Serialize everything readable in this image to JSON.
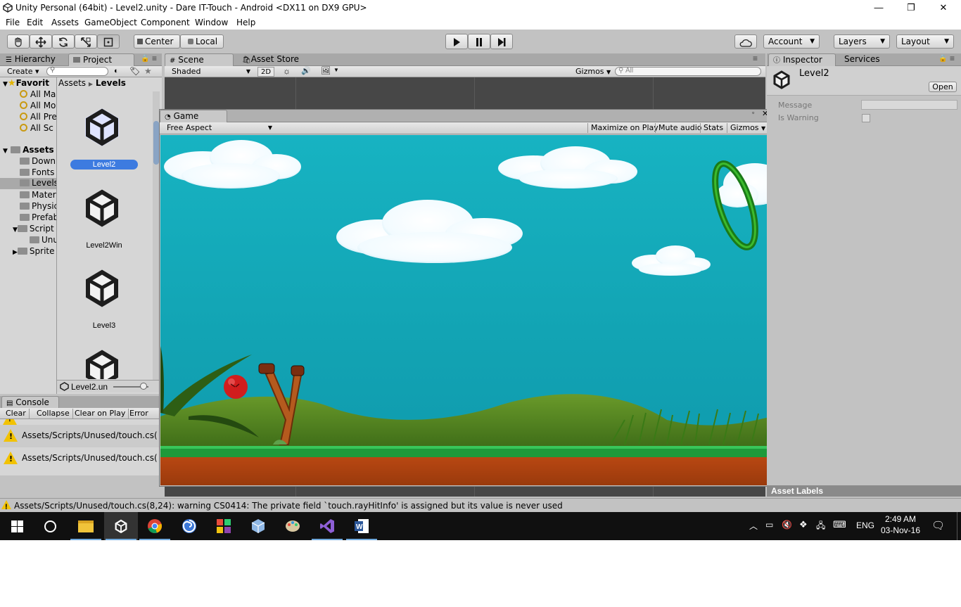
{
  "window": {
    "title": "Unity Personal (64bit) - Level2.unity - Dare IT-Touch - Android <DX11 on DX9 GPU>",
    "minimize": "—",
    "maximize": "❐",
    "close": "✕"
  },
  "menu": [
    "File",
    "Edit",
    "Assets",
    "GameObject",
    "Component",
    "Window",
    "Help"
  ],
  "toolbar": {
    "pivot_center": "Center",
    "pivot_local": "Local",
    "account": "Account",
    "layers": "Layers",
    "layout": "Layout"
  },
  "hierarchy": {
    "tab": "Hierarchy",
    "create": "Create"
  },
  "project": {
    "tab": "Project",
    "breadcrumb_root": "Assets",
    "breadcrumb_current": "Levels",
    "favorites_label": "Favorit",
    "favorites": [
      "All Ma",
      "All Mo",
      "All Pre",
      "All Sc"
    ],
    "assets_label": "Assets",
    "folders": [
      "Down",
      "Fonts",
      "Levels",
      "Mater",
      "Physic",
      "Prefab",
      "Script",
      "Unu",
      "Sprite"
    ],
    "items": [
      "Level2",
      "Level2Win",
      "Level3"
    ],
    "selected_file": "Level2.un"
  },
  "scene": {
    "tab": "Scene",
    "asset_store_tab": "Asset Store",
    "shading": "Shaded",
    "mode_2d": "2D",
    "gizmos": "Gizmos",
    "search_placeholder": "All"
  },
  "game": {
    "tab": "Game",
    "aspect": "Free Aspect",
    "maximize_on_play": "Maximize on Play",
    "mute_audio": "Mute audio",
    "stats": "Stats",
    "gizmos": "Gizmos"
  },
  "inspector": {
    "tab": "Inspector",
    "services_tab": "Services",
    "object_name": "Level2",
    "open_button": "Open",
    "message_label": "Message",
    "is_warning_label": "Is Warning",
    "asset_labels": "Asset Labels"
  },
  "console": {
    "tab": "Console",
    "buttons": [
      "Clear",
      "Collapse",
      "Clear on Play",
      "Error Pa"
    ],
    "entries": [
      "Assets/Scripts/Unused/touch.cs(",
      "Assets/Scripts/Unused/touch.cs("
    ]
  },
  "statusbar": {
    "message": "Assets/Scripts/Unused/touch.cs(8,24): warning CS0414: The private field `touch.rayHitInfo' is assigned but its value is never used"
  },
  "taskbar": {
    "language": "ENG",
    "time": "2:49 AM",
    "date": "03-Nov-16"
  }
}
